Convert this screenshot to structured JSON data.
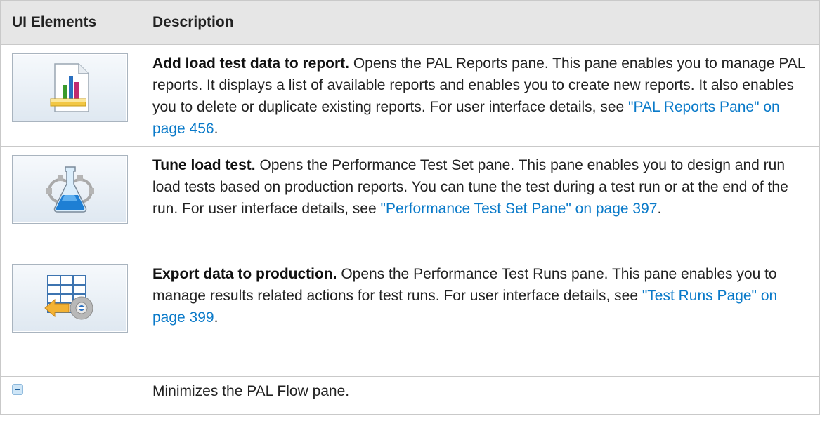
{
  "header": {
    "col1": "UI Elements",
    "col2": "Description"
  },
  "rows": [
    {
      "icon": "report-chart-icon",
      "title": "Add load test data to report.",
      "text": " Opens the PAL Reports pane. This pane enables you to manage PAL reports. It displays a list of available reports and enables you to create new reports. It also enables you to delete or duplicate existing reports. For user interface details, see ",
      "link": "\"PAL Reports Pane\" on page 456",
      "after": "."
    },
    {
      "icon": "gear-flask-icon",
      "title": "Tune load test.",
      "text": " Opens the Performance Test Set pane. This pane enables you to design and run load tests based on production reports. You can tune the test during a test run or at the end of the run. For user interface details, see ",
      "link": "\"Performance Test Set Pane\" on page 397",
      "after": "."
    },
    {
      "icon": "table-export-gear-icon",
      "title": "Export data to production.",
      "text": " Opens the Performance Test Runs pane. This pane enables you to manage results related actions for test runs. For user interface details, see ",
      "link": "\"Test Runs Page\" on page 399",
      "after": "."
    },
    {
      "icon": "minimize-icon",
      "text": "Minimizes the PAL Flow pane."
    }
  ],
  "colors": {
    "header_bg": "#e6e6e6",
    "link": "#0a7ac9",
    "border": "#c9c9c9"
  }
}
